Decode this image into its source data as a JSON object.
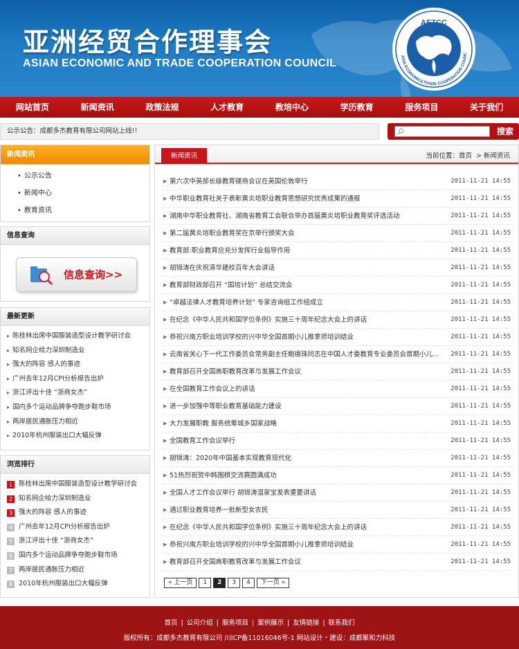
{
  "header": {
    "title": "亚洲经贸合作理事会",
    "subtitle": "ASIAN ECONOMIC AND TRADE COOPERATION COUNCIL",
    "logo_text": "AETCC",
    "logo_ring_text": "ASIA ECONOMIC&TRADE COOPERATION COUNCIL"
  },
  "nav": [
    "网站首页",
    "新闻资讯",
    "政策法规",
    "人才教育",
    "教培中心",
    "学历教育",
    "服务项目",
    "关于我们"
  ],
  "notice": "公示公告：成都多杰教育有限公司网站上线!！",
  "search": {
    "placeholder": "",
    "button": "搜索"
  },
  "sidebar": {
    "news_title": "新闻资讯",
    "news_items": [
      "公示公告",
      "新闻中心",
      "教育资讯"
    ],
    "query_title": "信息查询",
    "query_button": "信息查询>>",
    "latest_title": "最新更新",
    "latest_items": [
      "陈桂林出席中国服装造型设计教学研讨会",
      "知名网企给力深圳制造业",
      "强大的阵容 感人的事迹",
      "广州去年12月CPI分析报告出炉",
      "浙江评出十佳 “浙商女杰”",
      "国内多个运动品牌争夺跑步鞋市场",
      "两岸居民通胀压力相近",
      "2010年杭州服装出口大幅反弹"
    ],
    "ranking_title": "浏览排行",
    "ranking_items": [
      "陈桂林出席中国服装造型设计教学研讨会",
      "知名网企给力深圳制造业",
      "强大的阵容 感人的事迹",
      "广州去年12月CPI分析报告出炉",
      "浙江评出十佳 “浙商女杰”",
      "国内多个运动品牌争夺跑步鞋市场",
      "两岸居民通胀压力相近",
      "2010年杭州服装出口大幅反弹"
    ],
    "ranking_numbers": [
      "1",
      "2",
      "3",
      "4",
      "5",
      "6",
      "7",
      "8"
    ]
  },
  "main": {
    "tab": "新闻资讯",
    "crumb_prefix": "当前位置：",
    "crumb_home": "首页",
    "crumb_sep": ">",
    "crumb_current": "新闻资讯",
    "news": [
      {
        "title": "第六次中英部长级教育磋商会议在英国伦敦举行",
        "time": "2011-11-21 14:55"
      },
      {
        "title": "中华职业教育社关于表彰黄炎培职业教育思想研究优秀成果的通报",
        "time": "2011-11-21 14:55"
      },
      {
        "title": "湖南中华职业教育社、湖南省教育工会联合举办首届黄炎培职业教育奖评选活动",
        "time": "2011-11-21 14:55"
      },
      {
        "title": "第二届黄炎培职业教育奖在京举行颁奖大会",
        "time": "2011-11-21 14:55"
      },
      {
        "title": "教育部:职业教育应充分发挥行业指导作用",
        "time": "2011-11-21 14:55"
      },
      {
        "title": "胡锦涛在庆祝清华建校百年大会讲话",
        "time": "2011-11-21 14:55"
      },
      {
        "title": "教育部财政部召开 “国培计划” 总结交流会",
        "time": "2011-11-21 14:55"
      },
      {
        "title": "“卓越法律人才教育培养计划” 专家咨询组工作组成立",
        "time": "2011-11-21 14:55"
      },
      {
        "title": "在纪念《中华人民共和国学位条例》实施三十周年纪念大会上的讲话",
        "time": "2011-11-21 14:55"
      },
      {
        "title": "恭祝兴南方职业培训学校的兴中华全国首期小儿推拿师培训结业",
        "time": "2011-11-21 14:55"
      },
      {
        "title": "云南省关心下一代工作委员会常务副主任鲍德珠同志在中国人才委教育专业委员会首期小儿推拿师培训",
        "time": "2011-11-21 14:55"
      },
      {
        "title": "教育部召开全国高职教育改革与发展工作会议",
        "time": "2011-11-21 14:55"
      },
      {
        "title": "在全国教育工作会议上的讲话",
        "time": "2011-11-21 14:55"
      },
      {
        "title": "进一步加强中等职业教育基础能力建设",
        "time": "2011-11-21 14:55"
      },
      {
        "title": "大力发展职教 服务统筹城乡国家战略",
        "time": "2011-11-21 14:55"
      },
      {
        "title": "全国教育工作会议举行",
        "time": "2011-11-21 14:55"
      },
      {
        "title": "胡锦涛：2020年中国基本实现教育现代化",
        "time": "2011-11-21 14:55"
      },
      {
        "title": "51热烈祝贺中韩围棋交流赛圆满成功",
        "time": "2011-11-21 14:55"
      },
      {
        "title": "全国人才工作会议举行 胡锦涛温家宝发表重要讲话",
        "time": "2011-11-21 14:55"
      },
      {
        "title": "通过职业教育培养一批新型女农民",
        "time": "2011-11-21 14:55"
      },
      {
        "title": "在纪念《中华人民共和国学位条例》实施三十周年纪念大会上的讲话",
        "time": "2011-11-21 14:55"
      },
      {
        "title": "恭祝兴南方职业培训学校的兴中华全国首期小儿推拿师培训结业",
        "time": "2011-11-21 14:55"
      },
      {
        "title": "教育部召开全国高职教育改革与发展工作会议",
        "time": "2011-11-21 14:55"
      }
    ],
    "pager": {
      "prev": "« 上一页",
      "pages": [
        "1",
        "2",
        "3",
        "4"
      ],
      "current": "2",
      "next": "下一页 »"
    }
  },
  "footer": {
    "links": [
      "首页",
      "公司介绍",
      "服务项目",
      "案例展示",
      "友情链接",
      "联系我们"
    ],
    "separator": "|",
    "copyright": "版权所有：成都多杰教育有限公司 川ICP备11016046号-1 网站设计・建设：成都聚和力科技"
  },
  "colors": {
    "brand_blue": "#1f7bc4",
    "brand_red": "#c8151a",
    "accent_orange": "#f08a00",
    "footer_red": "#9e1414"
  }
}
